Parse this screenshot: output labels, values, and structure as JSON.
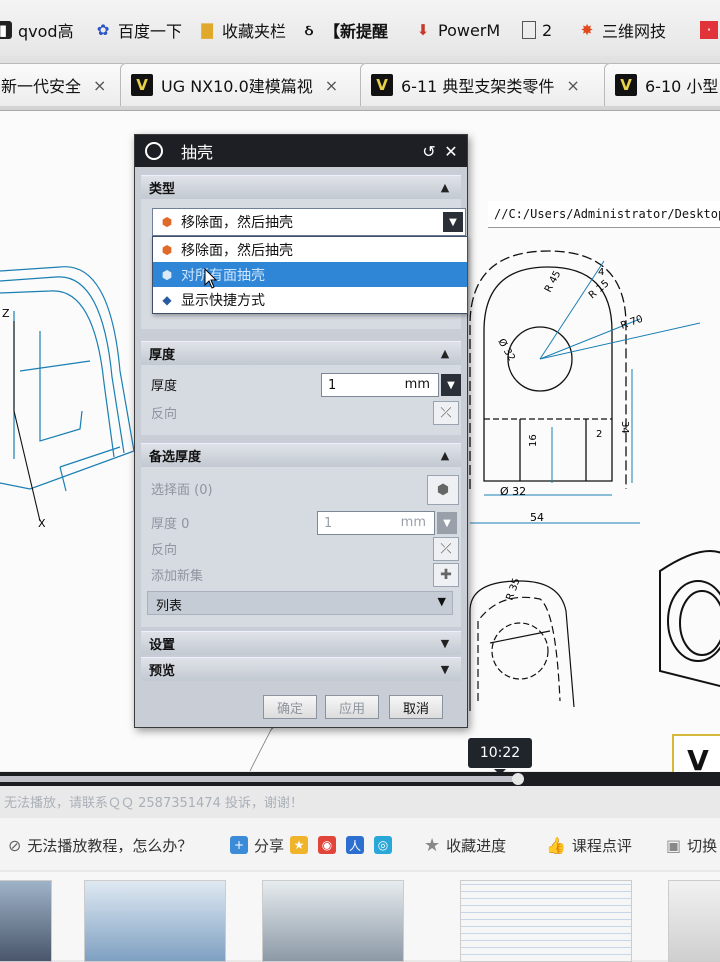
{
  "bookmarks": [
    {
      "label": "qvod高",
      "icon": "qvod-icon"
    },
    {
      "label": "百度一下",
      "icon": "baidu-paw-icon"
    },
    {
      "label": "收藏夹栏",
      "icon": "folder-icon"
    },
    {
      "label": "【新提醒",
      "icon": "notify-icon"
    },
    {
      "label": "PowerM",
      "icon": "powerm-icon"
    },
    {
      "label": "2",
      "icon": "page-icon"
    },
    {
      "label": "三维网技",
      "icon": "sanwei-icon"
    }
  ],
  "tabs": [
    {
      "label": "新一代安全",
      "close": "×"
    },
    {
      "label": "UG NX10.0建模篇视",
      "close": "×"
    },
    {
      "label": "6-11 典型支架类零件",
      "close": "×"
    },
    {
      "label": "6-10 小型"
    }
  ],
  "viewer": {
    "path": "//C:/Users/Administrator/Desktop/",
    "dims": [
      "R 45",
      "R 15",
      "4",
      "R 70",
      "Ø 32",
      "16",
      "2",
      "34",
      "Ø 32",
      "54",
      "R 35",
      "Z",
      "X"
    ]
  },
  "dialog": {
    "title": "抽壳",
    "reset_icon": "↺",
    "close_icon": "✕",
    "type_section": "类型",
    "type_selected": "移除面，然后抽壳",
    "type_options": [
      "移除面，然后抽壳",
      "对所有面抽壳",
      "显示快捷方式"
    ],
    "thickness_section": "厚度",
    "thickness_label": "厚度",
    "thickness_value": "1",
    "thickness_unit": "mm",
    "reverse_label": "反向",
    "alt_section": "备选厚度",
    "select_face_label": "选择面 (0)",
    "alt_thickness_label": "厚度 0",
    "alt_thickness_value": "1",
    "alt_unit": "mm",
    "alt_reverse_label": "反向",
    "add_set_label": "添加新集",
    "list_label": "列表",
    "settings_section": "设置",
    "preview_section": "预览",
    "ok_label": "确定",
    "apply_label": "应用",
    "cancel_label": "取消"
  },
  "player": {
    "time": "10:22",
    "progress": 0.72,
    "notice": "无法播放，请联系ＱＱ 2587351474 投诉，谢谢！"
  },
  "actions": {
    "help": "无法播放教程，怎么办？",
    "share": "分享",
    "favorite": "收藏进度",
    "review": "课程点评",
    "switch": "切换"
  },
  "colors": {
    "highlight": "#2f86d6",
    "cad_blue": "#1a7fb3",
    "dialog_bg": "#c9ced6"
  }
}
